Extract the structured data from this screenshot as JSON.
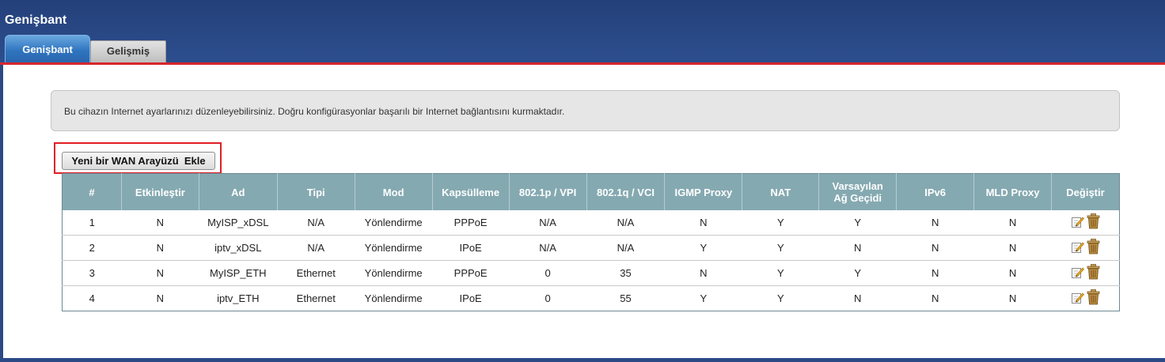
{
  "header": {
    "title": "Genişbant"
  },
  "tabs": [
    {
      "label": "Genişbant",
      "active": true
    },
    {
      "label": "Gelişmiş",
      "active": false
    }
  ],
  "info": {
    "text": "Bu cihazın Internet ayarlarınızı düzenleyebilirsiniz. Doğru konfigürasyonlar başarılı bir Internet bağlantısını kurmaktadır."
  },
  "toolbar": {
    "add_label": "Yeni bir WAN Arayüzü  Ekle"
  },
  "table": {
    "headers": [
      "#",
      "Etkinleştir",
      "Ad",
      "Tipi",
      "Mod",
      "Kapsülleme",
      "802.1p / VPI",
      "802.1q / VCI",
      "IGMP Proxy",
      "NAT",
      "Varsayılan Ağ Geçidi",
      "IPv6",
      "MLD Proxy",
      "Değiştir"
    ],
    "rows": [
      [
        "1",
        "N",
        "MyISP_xDSL",
        "N/A",
        "Yönlendirme",
        "PPPoE",
        "N/A",
        "N/A",
        "N",
        "Y",
        "Y",
        "N",
        "N"
      ],
      [
        "2",
        "N",
        "iptv_xDSL",
        "N/A",
        "Yönlendirme",
        "IPoE",
        "N/A",
        "N/A",
        "Y",
        "Y",
        "N",
        "N",
        "N"
      ],
      [
        "3",
        "N",
        "MyISP_ETH",
        "Ethernet",
        "Yönlendirme",
        "PPPoE",
        "0",
        "35",
        "N",
        "Y",
        "Y",
        "N",
        "N"
      ],
      [
        "4",
        "N",
        "iptv_ETH",
        "Ethernet",
        "Yönlendirme",
        "IPoE",
        "0",
        "55",
        "Y",
        "Y",
        "N",
        "N",
        "N"
      ]
    ]
  },
  "icons": {
    "edit": "edit-icon",
    "delete": "trash-icon"
  },
  "colors": {
    "header_bg": "#2b4a86",
    "accent_red": "#d8262c",
    "table_header_bg": "#85a9b1",
    "active_tab": "#2f74bf"
  }
}
